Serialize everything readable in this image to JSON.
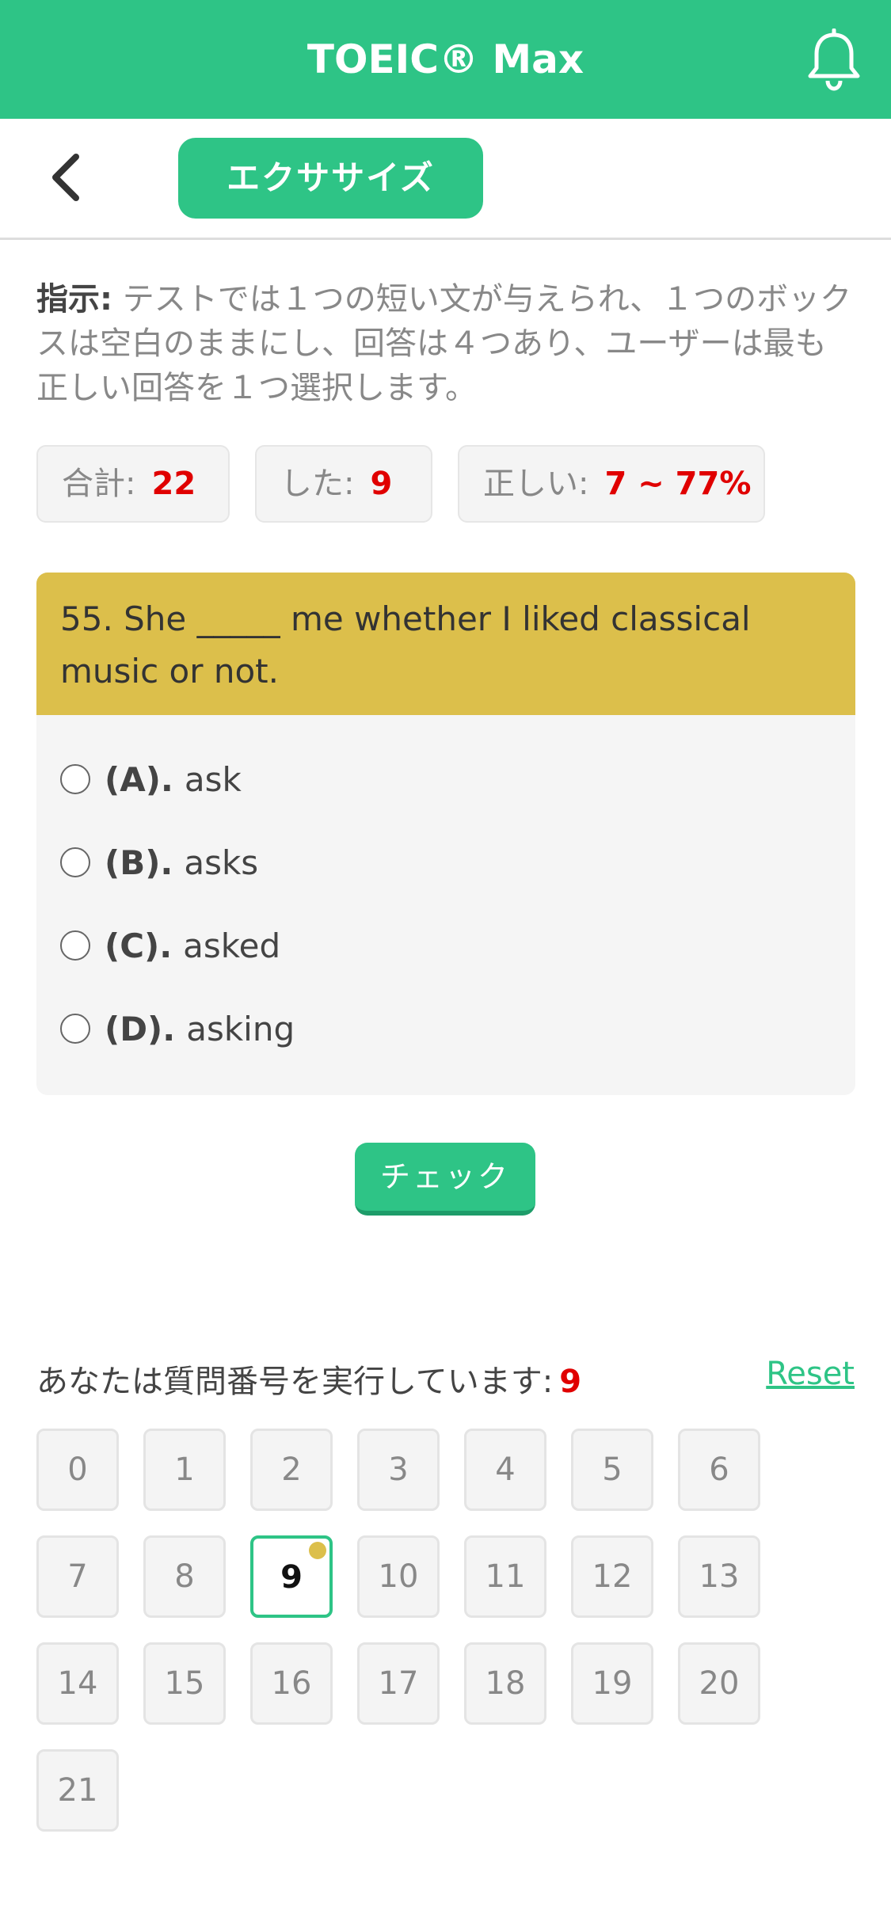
{
  "app": {
    "title": "TOEIC® Max"
  },
  "subbar": {
    "tab_label": "エクササイズ"
  },
  "instruction": {
    "label": "指示:",
    "text": " テストでは１つの短い文が与えられ、１つのボックスは空白のままにし、回答は４つあり、ユーザーは最も正しい回答を１つ選択します。"
  },
  "stats": {
    "total_label": "合計:",
    "total_value": "22",
    "done_label": "した:",
    "done_value": "9",
    "correct_label": "正しい:",
    "correct_value": "7 ~ 77%"
  },
  "question": {
    "text": "55. She _____ me whether I liked classical music or not.",
    "options": [
      {
        "letter": "(A).",
        "text": "ask"
      },
      {
        "letter": "(B).",
        "text": "asks"
      },
      {
        "letter": "(C).",
        "text": "asked"
      },
      {
        "letter": "(D).",
        "text": "asking"
      }
    ]
  },
  "check_button": "チェック",
  "progress": {
    "label": "あなたは質問番号を実行しています:",
    "current": "9",
    "reset": "Reset"
  },
  "numbers": [
    "0",
    "1",
    "2",
    "3",
    "4",
    "5",
    "6",
    "7",
    "8",
    "9",
    "10",
    "11",
    "12",
    "13",
    "14",
    "15",
    "16",
    "17",
    "18",
    "19",
    "20",
    "21"
  ],
  "colors": {
    "accent": "#2ec486",
    "question_bg": "#dcbf4b",
    "highlight": "#e00000"
  },
  "icons": {
    "bell": "bell-icon",
    "back": "chevron-left-icon"
  }
}
